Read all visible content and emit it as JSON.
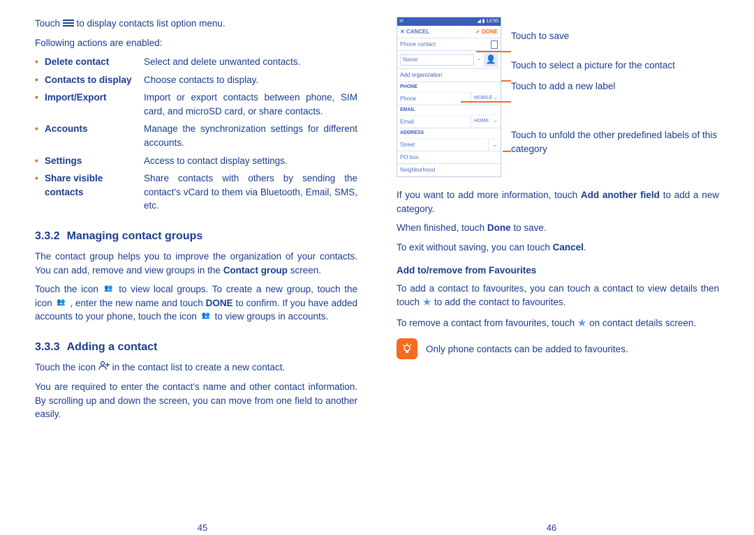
{
  "left": {
    "intro1_a": "Touch ",
    "intro1_b": " to display contacts list option menu.",
    "intro2": "Following actions are enabled:",
    "options": [
      {
        "term": "Delete contact",
        "desc": "Select and delete unwanted contacts."
      },
      {
        "term": "Contacts to display",
        "desc": "Choose contacts to display."
      },
      {
        "term": "Import/Export",
        "desc": "Import or export contacts between phone, SIM card, and microSD card, or share contacts."
      },
      {
        "term": "Accounts",
        "desc": "Manage the synchronization settings for different accounts."
      },
      {
        "term": "Settings",
        "desc": "Access to contact display settings."
      },
      {
        "term": "Share visible contacts",
        "desc": "Share contacts with others by sending the contact's vCard to them via Bluetooth, Email, SMS, etc."
      }
    ],
    "h332_num": "3.3.2",
    "h332": "Managing contact groups",
    "p332a": "The contact group helps you to improve the organization of your contacts. You can add, remove and view groups in the ",
    "p332a_b": "Contact group",
    "p332a_end": " screen.",
    "p332b_a": "Touch the icon ",
    "p332b_b": " to view local groups. To create a new group, touch the icon ",
    "p332b_c": ", enter the new name and touch ",
    "p332b_done": "DONE",
    "p332b_d": " to confirm. If you have added accounts to your phone, touch the icon ",
    "p332b_e": " to view groups in accounts.",
    "h333_num": "3.3.3",
    "h333": "Adding a contact",
    "p333a_a": "Touch the icon ",
    "p333a_b": " in the contact list to create a new contact.",
    "p333b": "You are required to enter the contact's name and other contact information. By scrolling up and down the screen, you can move from one field to another easily.",
    "page": "45"
  },
  "right": {
    "callouts": {
      "save": "Touch to save",
      "picture": "Touch to select a picture for the contact",
      "label": "Touch to add a new label",
      "unfold": "Touch to unfold the other predefined labels of this category"
    },
    "mock": {
      "time": "13:50",
      "cancel": "✕ CANCEL",
      "done": "✓ DONE",
      "phonecontact": "Phone contact",
      "name": "Name",
      "addorg": "Add organization",
      "phone_sect": "PHONE",
      "phone_field": "Phone",
      "mobile": "MOBILE",
      "email_sect": "EMAIL",
      "email_field": "Email",
      "home": "HOME",
      "addr_sect": "ADDRESS",
      "street": "Street",
      "pobox": "PO box",
      "neighborhood": "Neighborhood"
    },
    "p_add_a": "If you want to add more information, touch ",
    "p_add_b": "Add another field",
    "p_add_c": " to add a new category.",
    "p_done_a": "When finished, touch ",
    "p_done_b": "Done",
    "p_done_c": " to save.",
    "p_cancel_a": "To exit without saving, you can touch ",
    "p_cancel_b": "Cancel",
    "p_cancel_c": ".",
    "h_fav": "Add to/remove from Favourites",
    "p_fav1_a": "To add a contact to favourites, you can touch a contact to view details then touch ",
    "p_fav1_b": " to add the contact to favourites.",
    "p_fav2_a": "To remove a contact from favourites, touch ",
    "p_fav2_b": " on contact details screen.",
    "tip": "Only phone contacts can be added to favourites.",
    "page": "46"
  }
}
